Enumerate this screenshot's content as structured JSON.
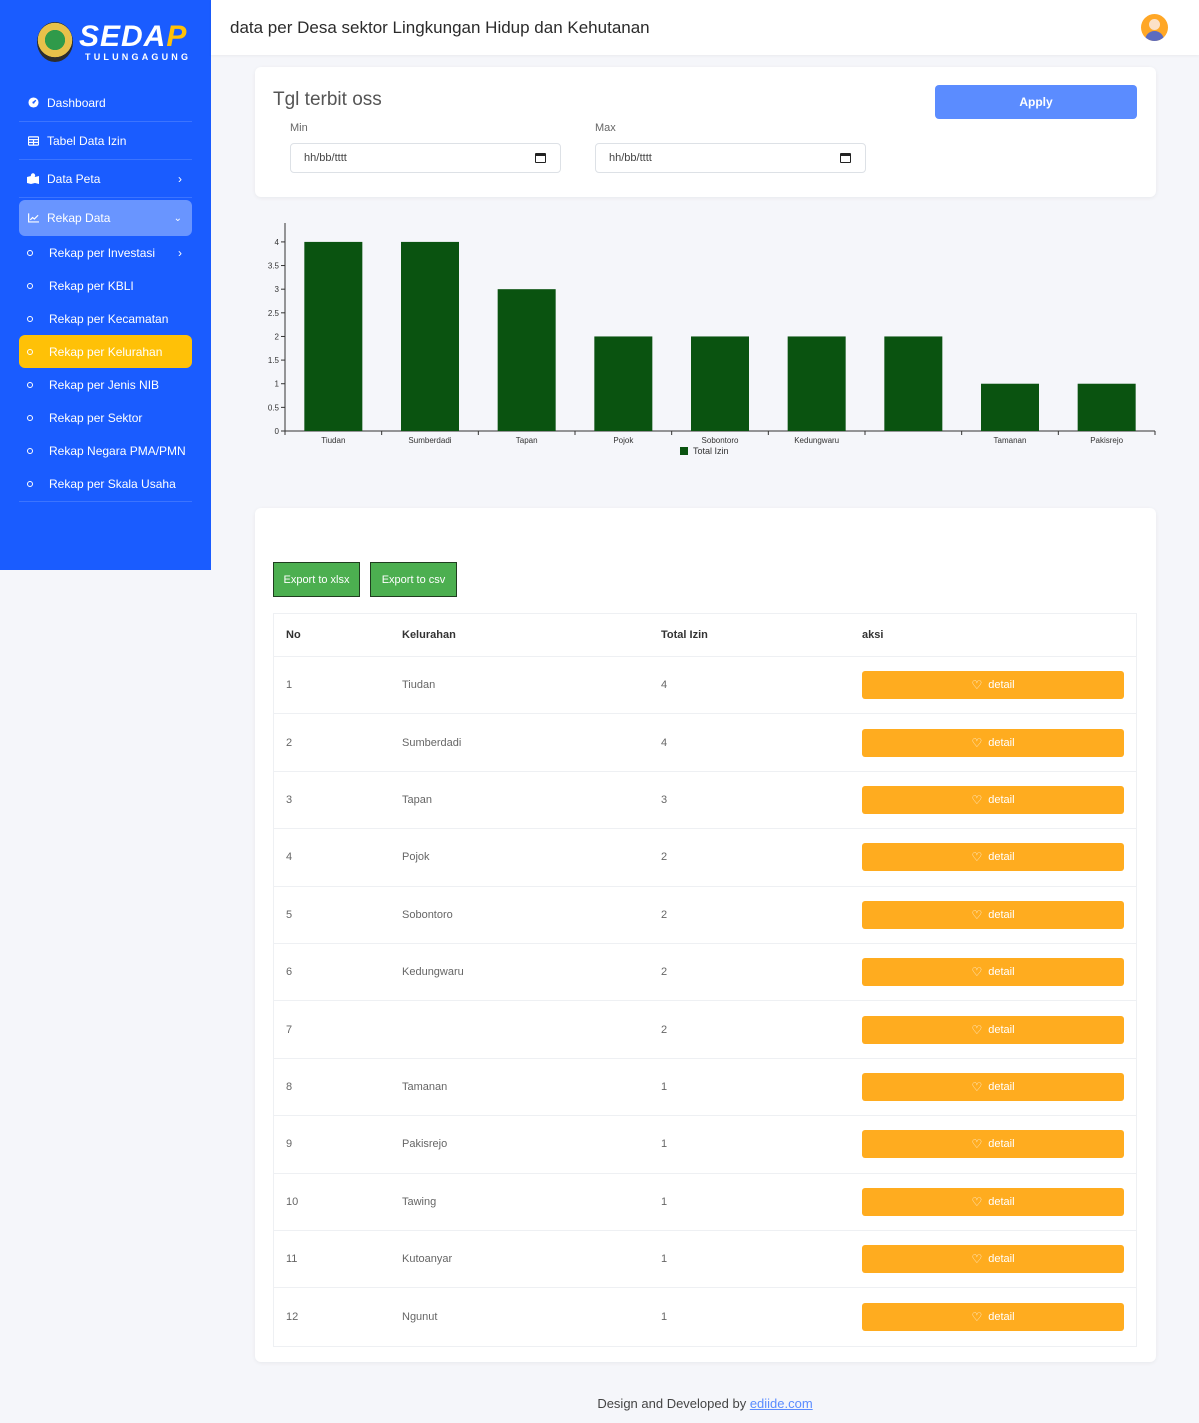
{
  "brand": {
    "name_main": "SEDA",
    "name_accent": "P",
    "subtitle": "TULUNGAGUNG"
  },
  "header": {
    "title": "data per Desa sektor Lingkungan Hidup dan Kehutanan"
  },
  "sidebar": {
    "items": [
      {
        "label": "Dashboard",
        "icon": "dashboard-icon"
      },
      {
        "label": "Tabel Data Izin",
        "icon": "table-icon"
      },
      {
        "label": "Data Peta",
        "icon": "map-icon"
      },
      {
        "label": "Rekap Data",
        "icon": "chart-line-icon"
      }
    ],
    "subitems": [
      {
        "label": "Rekap per Investasi"
      },
      {
        "label": "Rekap per KBLI"
      },
      {
        "label": "Rekap per Kecamatan"
      },
      {
        "label": "Rekap per Kelurahan"
      },
      {
        "label": "Rekap per Jenis NIB"
      },
      {
        "label": "Rekap per Sektor"
      },
      {
        "label": "Rekap Negara PMA/PMN"
      },
      {
        "label": "Rekap per Skala Usaha"
      }
    ]
  },
  "filter": {
    "title": "Tgl terbit oss",
    "min_label": "Min",
    "max_label": "Max",
    "min_value": "hh/bb/tttt",
    "max_value": "hh/bb/tttt",
    "apply_label": "Apply"
  },
  "chart_data": {
    "type": "bar",
    "categories": [
      "Tiudan",
      "Sumberdadi",
      "Tapan",
      "Pojok",
      "Sobontoro",
      "Kedungwaru",
      "",
      "Tamanan",
      "Pakisrejo"
    ],
    "series": [
      {
        "name": "Total Izin",
        "values": [
          4,
          4,
          3,
          2,
          2,
          2,
          2,
          1,
          1
        ],
        "color": "#0a5310"
      }
    ],
    "yticks": [
      "0",
      "0.5",
      "1",
      "1.5",
      "2",
      "2.5",
      "3",
      "3.5",
      "4"
    ],
    "ylim": [
      0,
      4.4
    ],
    "legend": "bottom-center",
    "grid": false
  },
  "export": {
    "xlsx_label": "Export to xlsx",
    "csv_label": "Export to csv"
  },
  "table": {
    "headers": {
      "no": "No",
      "kelurahan": "Kelurahan",
      "total": "Total Izin",
      "aksi": "aksi"
    },
    "detail_label": "detail",
    "rows": [
      {
        "no": "1",
        "kelurahan": "Tiudan",
        "total": "4"
      },
      {
        "no": "2",
        "kelurahan": "Sumberdadi",
        "total": "4"
      },
      {
        "no": "3",
        "kelurahan": "Tapan",
        "total": "3"
      },
      {
        "no": "4",
        "kelurahan": "Pojok",
        "total": "2"
      },
      {
        "no": "5",
        "kelurahan": "Sobontoro",
        "total": "2"
      },
      {
        "no": "6",
        "kelurahan": "Kedungwaru",
        "total": "2"
      },
      {
        "no": "7",
        "kelurahan": "",
        "total": "2"
      },
      {
        "no": "8",
        "kelurahan": "Tamanan",
        "total": "1"
      },
      {
        "no": "9",
        "kelurahan": "Pakisrejo",
        "total": "1"
      },
      {
        "no": "10",
        "kelurahan": "Tawing",
        "total": "1"
      },
      {
        "no": "11",
        "kelurahan": "Kutoanyar",
        "total": "1"
      },
      {
        "no": "12",
        "kelurahan": "Ngunut",
        "total": "1"
      }
    ]
  },
  "footer": {
    "text": "Design and Developed by ",
    "link": "ediide.com"
  },
  "colors": {
    "sidebar": "#1a5cff",
    "active": "#ffc107",
    "apply": "#5b8cff",
    "detail": "#ffac1f",
    "export": "#4caf50",
    "bar": "#0a5310"
  }
}
